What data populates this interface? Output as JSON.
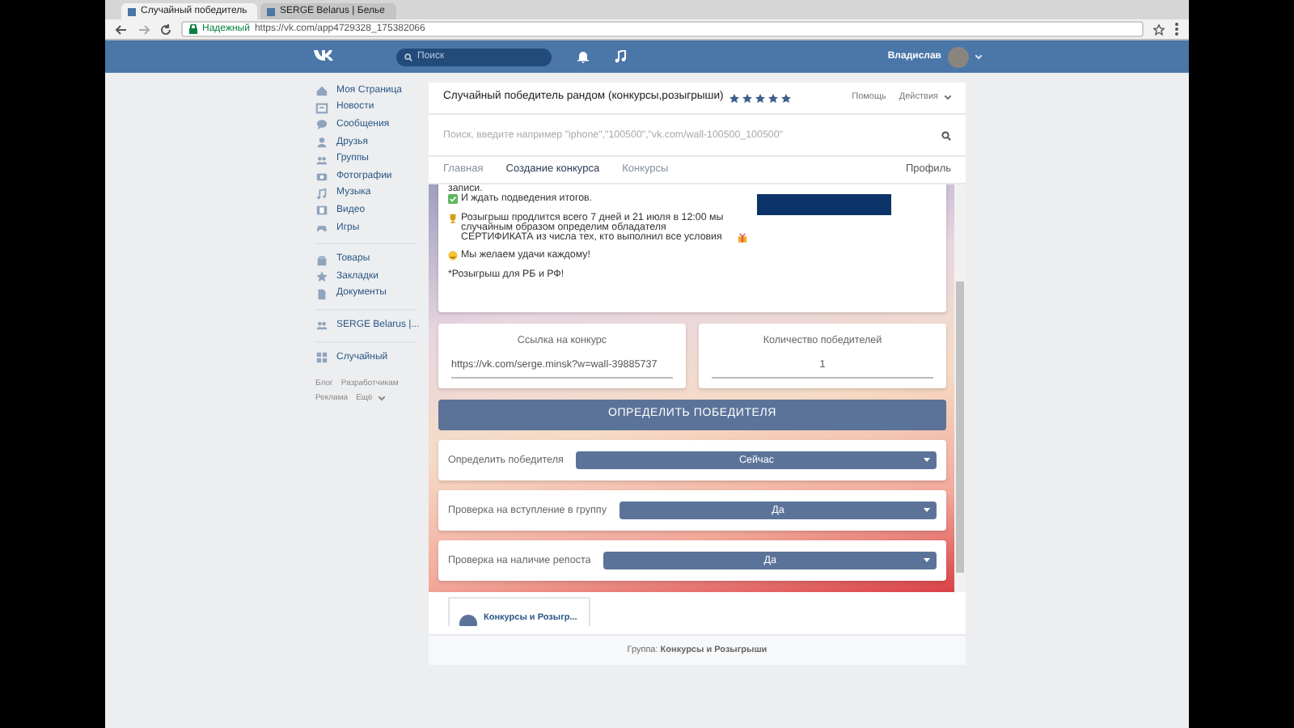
{
  "browser": {
    "tabs": [
      {
        "label": "Случайный победитель",
        "selected": true
      },
      {
        "label": "SERGE Belarus | Белье",
        "selected": false
      }
    ],
    "address": {
      "secure_label": "Надежный",
      "url": "https://vk.com/app4729328_175382066"
    }
  },
  "vk_header": {
    "search_placeholder": "Поиск",
    "user_name": "Владислав"
  },
  "sidebar": {
    "sections": [
      [
        "Моя Страница",
        "Новости",
        "Сообщения",
        "Друзья",
        "Группы",
        "Фотографии",
        "Музыка",
        "Видео",
        "Игры"
      ],
      [
        "Товары",
        "Закладки",
        "Документы"
      ],
      [
        "SERGE Belarus |..."
      ],
      [
        "Случайный"
      ]
    ],
    "footer_links": [
      "Блог",
      "Разработчикам",
      "Реклама",
      "Ещё"
    ]
  },
  "app": {
    "title": "Случайный победитель рандом (конкурсы,розыгрыши)",
    "stars": 5,
    "header_links": [
      "Помощь",
      "Действия"
    ],
    "search": {
      "placeholder": "Поиск, введите например \"iphone\",\"100500\",\"vk.com/wall-100500_100500\""
    },
    "nav": [
      {
        "label": "Главная",
        "selected": false
      },
      {
        "label": "Создание конкурса",
        "selected": true
      },
      {
        "label": "Конкурсы",
        "selected": false
      }
    ],
    "profile_link": "Профиль",
    "post_paragraphs": [
      [
        {
          "text": "записи.",
          "kind": "plain"
        },
        {
          "text": "И ждать подведения итогов.",
          "kind": "check"
        }
      ],
      [
        {
          "text": "Розыгрыш продлится всего 7 дней и 21 июля в 12:00 мы случайным образом определим обладателя СЕРТИФИКАТА из числа тех, кто выполнил все условия",
          "kind": "trophy"
        }
      ],
      [
        {
          "text": "Мы желаем удачи каждому!",
          "kind": "smile"
        }
      ],
      [
        {
          "text": "*Розыгрыш для РБ и РФ!",
          "kind": "plain"
        }
      ]
    ],
    "fields": [
      {
        "label": "Ссылка на конкурс",
        "value": "https://vk.com/serge.minsk?w=wall-39885737"
      },
      {
        "label": "Количество победителей",
        "value": "1"
      }
    ],
    "main_button": "ОПРЕДЕЛИТЬ ПОБЕДИТЕЛЯ",
    "settings": [
      {
        "label": "Определить победителя",
        "value": "Сейчас"
      },
      {
        "label": "Проверка на вступление в группу",
        "value": "Да"
      },
      {
        "label": "Проверка на наличие репоста",
        "value": "Да"
      }
    ],
    "group_card": "Конкурсы и Розыгр...",
    "footer": "Группа: **Конкурсы и Розыгрыши**"
  }
}
